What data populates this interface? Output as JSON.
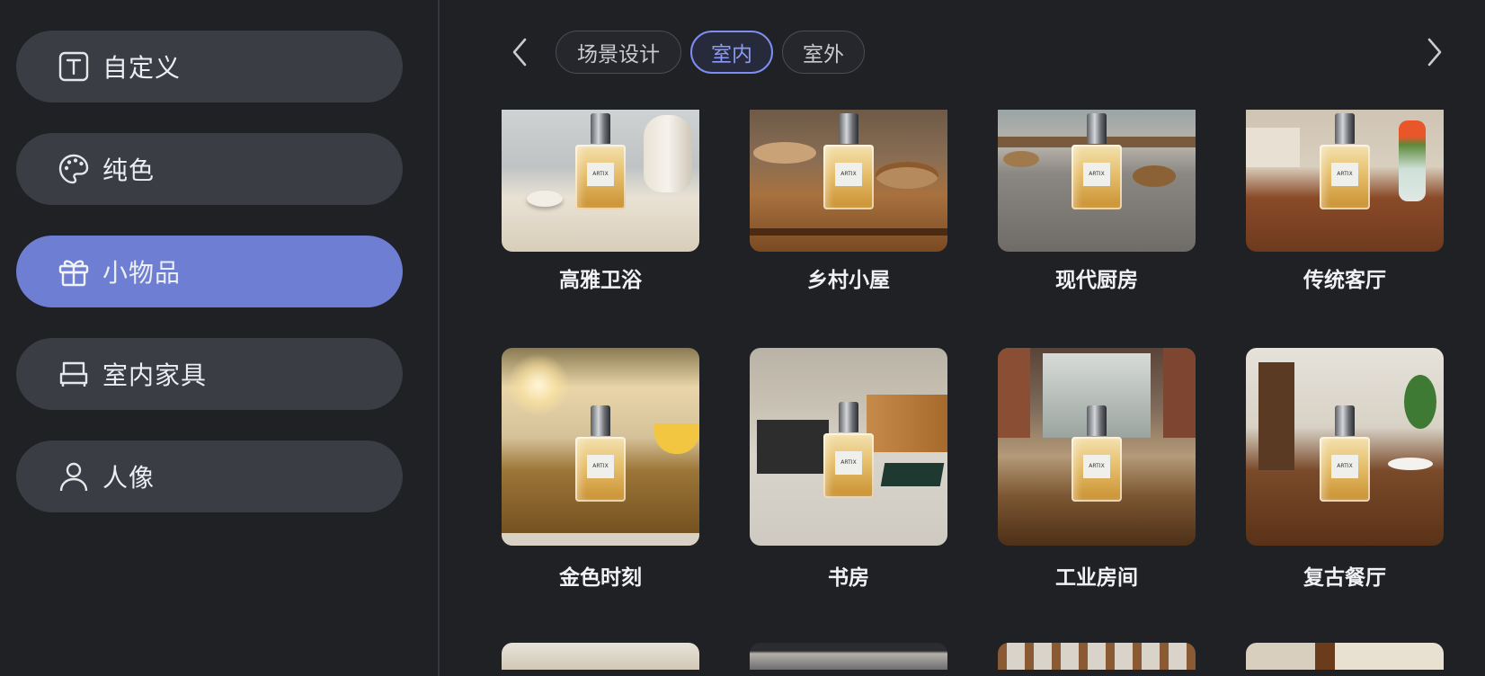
{
  "sidebar": {
    "items": [
      {
        "label": "自定义",
        "icon": "text-box-icon",
        "active": false
      },
      {
        "label": "纯色",
        "icon": "palette-icon",
        "active": false
      },
      {
        "label": "小物品",
        "icon": "gift-icon",
        "active": true
      },
      {
        "label": "室内家具",
        "icon": "sofa-icon",
        "active": false
      },
      {
        "label": "人像",
        "icon": "person-icon",
        "active": false
      }
    ]
  },
  "filters": {
    "chips": [
      {
        "label": "场景设计",
        "active": false
      },
      {
        "label": "室内",
        "active": true
      },
      {
        "label": "室外",
        "active": false
      }
    ],
    "prev_icon": "chevron-left-icon",
    "next_icon": "chevron-right-icon"
  },
  "product_label": "ARTIX",
  "scenes": [
    {
      "title": "高雅卫浴"
    },
    {
      "title": "乡村小屋"
    },
    {
      "title": "现代厨房"
    },
    {
      "title": "传统客厅"
    },
    {
      "title": "金色时刻"
    },
    {
      "title": "书房"
    },
    {
      "title": "工业房间"
    },
    {
      "title": "复古餐厅"
    }
  ],
  "colors": {
    "accent": "#6e7fd3",
    "chip_active": "#8b9bf5",
    "background": "#1f2125",
    "pill": "#3a3d43"
  }
}
